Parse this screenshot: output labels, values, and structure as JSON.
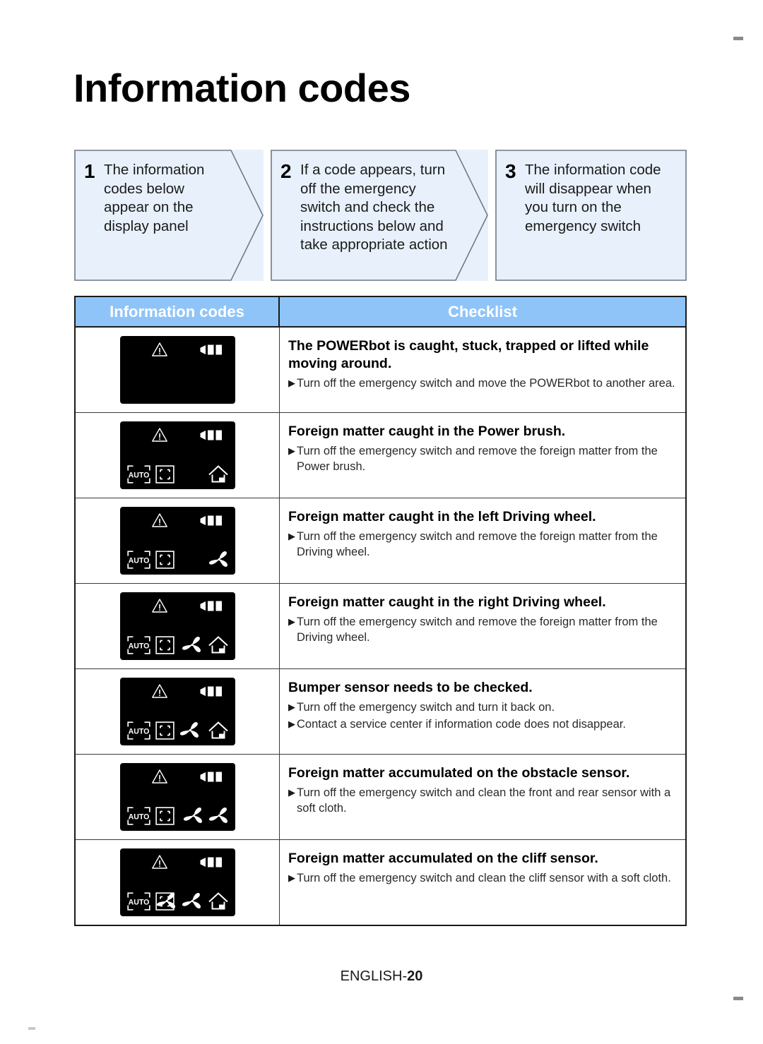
{
  "page": {
    "title": "Information codes",
    "footer_label": "ENGLISH-",
    "footer_page": "20"
  },
  "steps": [
    {
      "number": "1",
      "text": "The information codes below appear on the display panel"
    },
    {
      "number": "2",
      "text": "If a code appears, turn off the emergency switch and check the instructions below and take appropriate action"
    },
    {
      "number": "3",
      "text": "The information code will disappear when you turn on the emergency switch"
    }
  ],
  "table": {
    "header": {
      "codes": "Information codes",
      "checklist": "Checklist",
      "background_color": "#8FC4F8",
      "text_color": "#FFFFFF"
    },
    "rows": [
      {
        "panel": {
          "warning_icon": "warning-triangle-icon",
          "battery_icon": "battery-icon",
          "bottom_left_icons": [],
          "bottom_mid_icons": [],
          "bottom_right_icons": []
        },
        "title": "The POWERbot is caught, stuck, trapped or lifted while moving around.",
        "bullets": [
          "Turn off the emergency switch and move the POWERbot to another area."
        ]
      },
      {
        "panel": {
          "warning_icon": "warning-triangle-icon",
          "battery_icon": "battery-icon",
          "bottom_left_icons": [
            "auto-icon",
            "spot-icon"
          ],
          "bottom_mid_icons": [],
          "bottom_right_icons": [
            "home-dock-icon"
          ]
        },
        "title": "Foreign matter caught in the Power brush.",
        "bullets": [
          "Turn off the emergency switch and remove the foreign matter from the Power brush."
        ]
      },
      {
        "panel": {
          "warning_icon": "warning-triangle-icon",
          "battery_icon": "battery-icon",
          "bottom_left_icons": [
            "auto-icon",
            "spot-icon"
          ],
          "bottom_mid_icons": [],
          "bottom_right_icons": [
            "fan-icon"
          ]
        },
        "title": "Foreign matter caught in the left Driving wheel.",
        "bullets": [
          "Turn off the emergency switch and remove the foreign matter from the Driving wheel."
        ]
      },
      {
        "panel": {
          "warning_icon": "warning-triangle-icon",
          "battery_icon": "battery-icon",
          "bottom_left_icons": [
            "auto-icon",
            "spot-icon"
          ],
          "bottom_mid_icons": [],
          "bottom_right_icons": [
            "fan-icon",
            "home-dock-icon"
          ]
        },
        "title": "Foreign matter caught in the right Driving wheel.",
        "bullets": [
          "Turn off the emergency switch and remove the foreign matter from the Driving wheel."
        ]
      },
      {
        "panel": {
          "warning_icon": "warning-triangle-icon",
          "battery_icon": "battery-icon",
          "bottom_left_icons": [
            "auto-icon",
            "spot-icon"
          ],
          "bottom_mid_icons": [
            "fan-icon"
          ],
          "bottom_right_icons": [
            "home-dock-icon"
          ]
        },
        "title": "Bumper sensor needs to be checked.",
        "bullets": [
          "Turn off the emergency switch and turn it back on.",
          "Contact a service center if information code does not disappear."
        ]
      },
      {
        "panel": {
          "warning_icon": "warning-triangle-icon",
          "battery_icon": "battery-icon",
          "bottom_left_icons": [
            "auto-icon",
            "spot-icon"
          ],
          "bottom_mid_icons": [],
          "bottom_right_icons": [
            "fan-icon",
            "fan-icon"
          ]
        },
        "title": "Foreign matter accumulated on the obstacle sensor.",
        "bullets": [
          "Turn off the emergency switch and clean the front and rear sensor with a soft cloth."
        ]
      },
      {
        "panel": {
          "warning_icon": "warning-triangle-icon",
          "battery_icon": "battery-icon",
          "bottom_left_icons": [
            "auto-icon",
            "spot-icon"
          ],
          "bottom_mid_icons": [],
          "bottom_right_icons": [
            "fan-icon",
            "fan-icon",
            "home-dock-icon"
          ]
        },
        "title": "Foreign matter accumulated on the cliff sensor.",
        "bullets": [
          "Turn off the emergency switch and clean the cliff sensor with a soft cloth."
        ]
      }
    ]
  },
  "bullet_marker": "▶"
}
